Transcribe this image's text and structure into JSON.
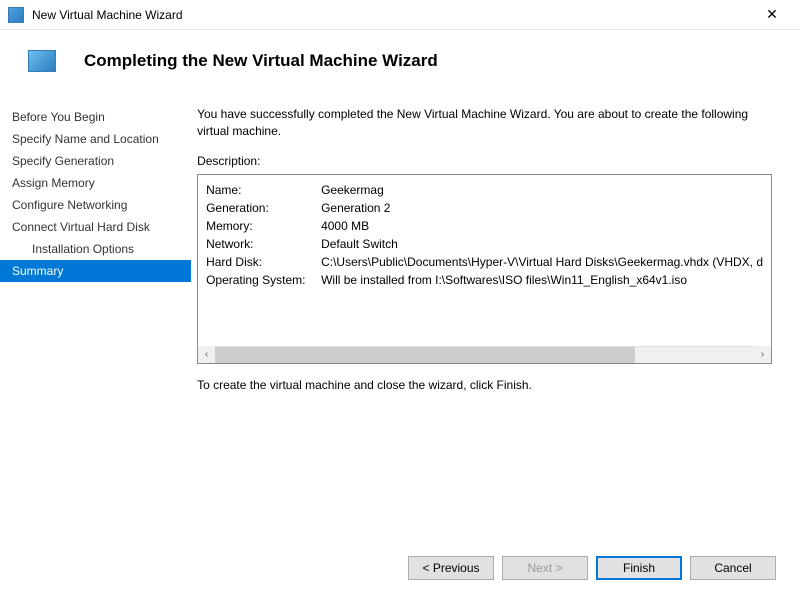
{
  "window": {
    "title": "New Virtual Machine Wizard",
    "close_glyph": "✕"
  },
  "header": {
    "title": "Completing the New Virtual Machine Wizard"
  },
  "sidebar": {
    "items": [
      {
        "label": "Before You Begin",
        "indent": false
      },
      {
        "label": "Specify Name and Location",
        "indent": false
      },
      {
        "label": "Specify Generation",
        "indent": false
      },
      {
        "label": "Assign Memory",
        "indent": false
      },
      {
        "label": "Configure Networking",
        "indent": false
      },
      {
        "label": "Connect Virtual Hard Disk",
        "indent": false
      },
      {
        "label": "Installation Options",
        "indent": true
      },
      {
        "label": "Summary",
        "indent": false,
        "selected": true
      }
    ]
  },
  "content": {
    "intro": "You have successfully completed the New Virtual Machine Wizard. You are about to create the following virtual machine.",
    "description_label": "Description:",
    "rows": [
      {
        "key": "Name:",
        "value": "Geekermag"
      },
      {
        "key": "Generation:",
        "value": "Generation 2"
      },
      {
        "key": "Memory:",
        "value": "4000 MB"
      },
      {
        "key": "Network:",
        "value": "Default Switch"
      },
      {
        "key": "Hard Disk:",
        "value": "C:\\Users\\Public\\Documents\\Hyper-V\\Virtual Hard Disks\\Geekermag.vhdx (VHDX, d"
      },
      {
        "key": "Operating System:",
        "value": "Will be installed from I:\\Softwares\\ISO files\\Win11_English_x64v1.iso"
      }
    ],
    "instruction": "To create the virtual machine and close the wizard, click Finish."
  },
  "buttons": {
    "previous": "< Previous",
    "next": "Next >",
    "finish": "Finish",
    "cancel": "Cancel"
  },
  "scroll": {
    "left_glyph": "‹",
    "right_glyph": "›"
  }
}
